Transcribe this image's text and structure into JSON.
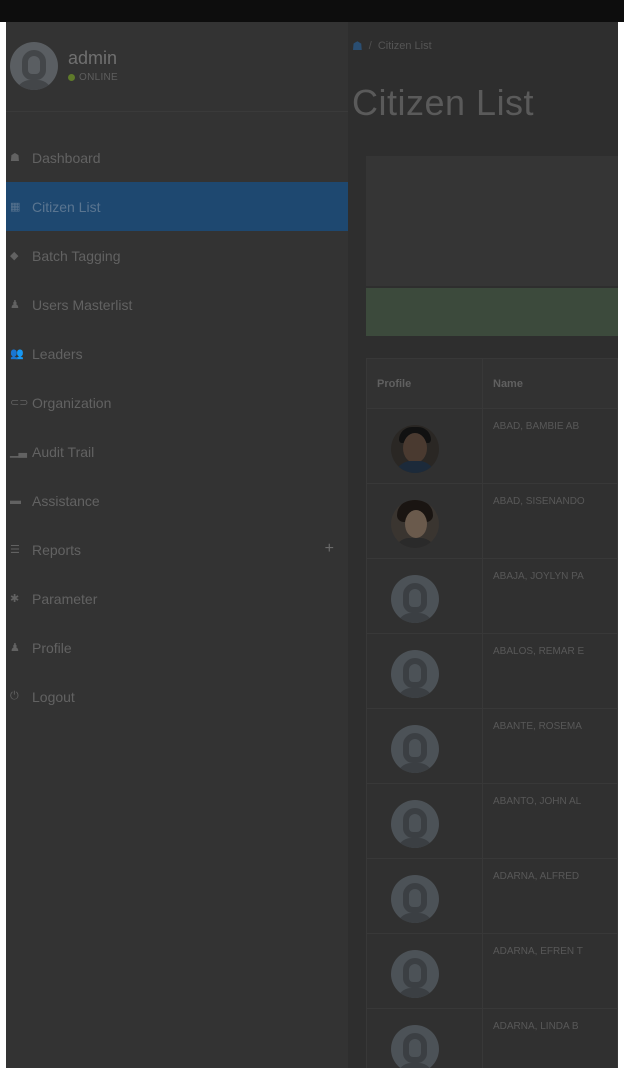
{
  "user": {
    "name": "admin",
    "status": "ONLINE"
  },
  "menu": [
    {
      "label": "Dashboard",
      "icon": "dashboard-icon",
      "glyph": "☗",
      "active": false
    },
    {
      "label": "Citizen List",
      "icon": "calendar-icon",
      "glyph": "▦",
      "active": true
    },
    {
      "label": "Batch Tagging",
      "icon": "tag-icon",
      "glyph": "◆",
      "active": false
    },
    {
      "label": "Users Masterlist",
      "icon": "user-icon",
      "glyph": "♟",
      "active": false
    },
    {
      "label": "Leaders",
      "icon": "users-icon",
      "glyph": "👥",
      "active": false
    },
    {
      "label": "Organization",
      "icon": "ticket-icon",
      "glyph": "⊂⊃",
      "active": false
    },
    {
      "label": "Audit Trail",
      "icon": "chart-icon",
      "glyph": "▁▃",
      "active": false
    },
    {
      "label": "Assistance",
      "icon": "briefcase-icon",
      "glyph": "▬",
      "active": false
    },
    {
      "label": "Reports",
      "icon": "list-icon",
      "glyph": "☰",
      "active": false,
      "has_submenu": true
    },
    {
      "label": "Parameter",
      "icon": "gear-icon",
      "glyph": "✱",
      "active": false
    },
    {
      "label": "Profile",
      "icon": "user-icon",
      "glyph": "♟",
      "active": false
    },
    {
      "label": "Logout",
      "icon": "power-icon",
      "glyph": "⏻",
      "active": false
    }
  ],
  "submenu_glyph": "+",
  "breadcrumb": {
    "current": "Citizen List",
    "separator": "/"
  },
  "page_title": "Citizen List",
  "table": {
    "headers": [
      "Profile",
      "Name"
    ],
    "rows": [
      {
        "name": "ABAD, BAMBIE AB",
        "photo": "photo"
      },
      {
        "name": "ABAD, SISENANDO",
        "photo": "photo2"
      },
      {
        "name": "ABAJA, JOYLYN PA",
        "photo": "default"
      },
      {
        "name": "ABALOS, REMAR E",
        "photo": "default"
      },
      {
        "name": "ABANTE, ROSEMA",
        "photo": "default"
      },
      {
        "name": "ABANTO, JOHN AL",
        "photo": "default"
      },
      {
        "name": "ADARNA, ALFRED",
        "photo": "default"
      },
      {
        "name": "ADARNA, EFREN T",
        "photo": "default"
      },
      {
        "name": "ADARNA, LINDA B",
        "photo": "default"
      }
    ]
  }
}
